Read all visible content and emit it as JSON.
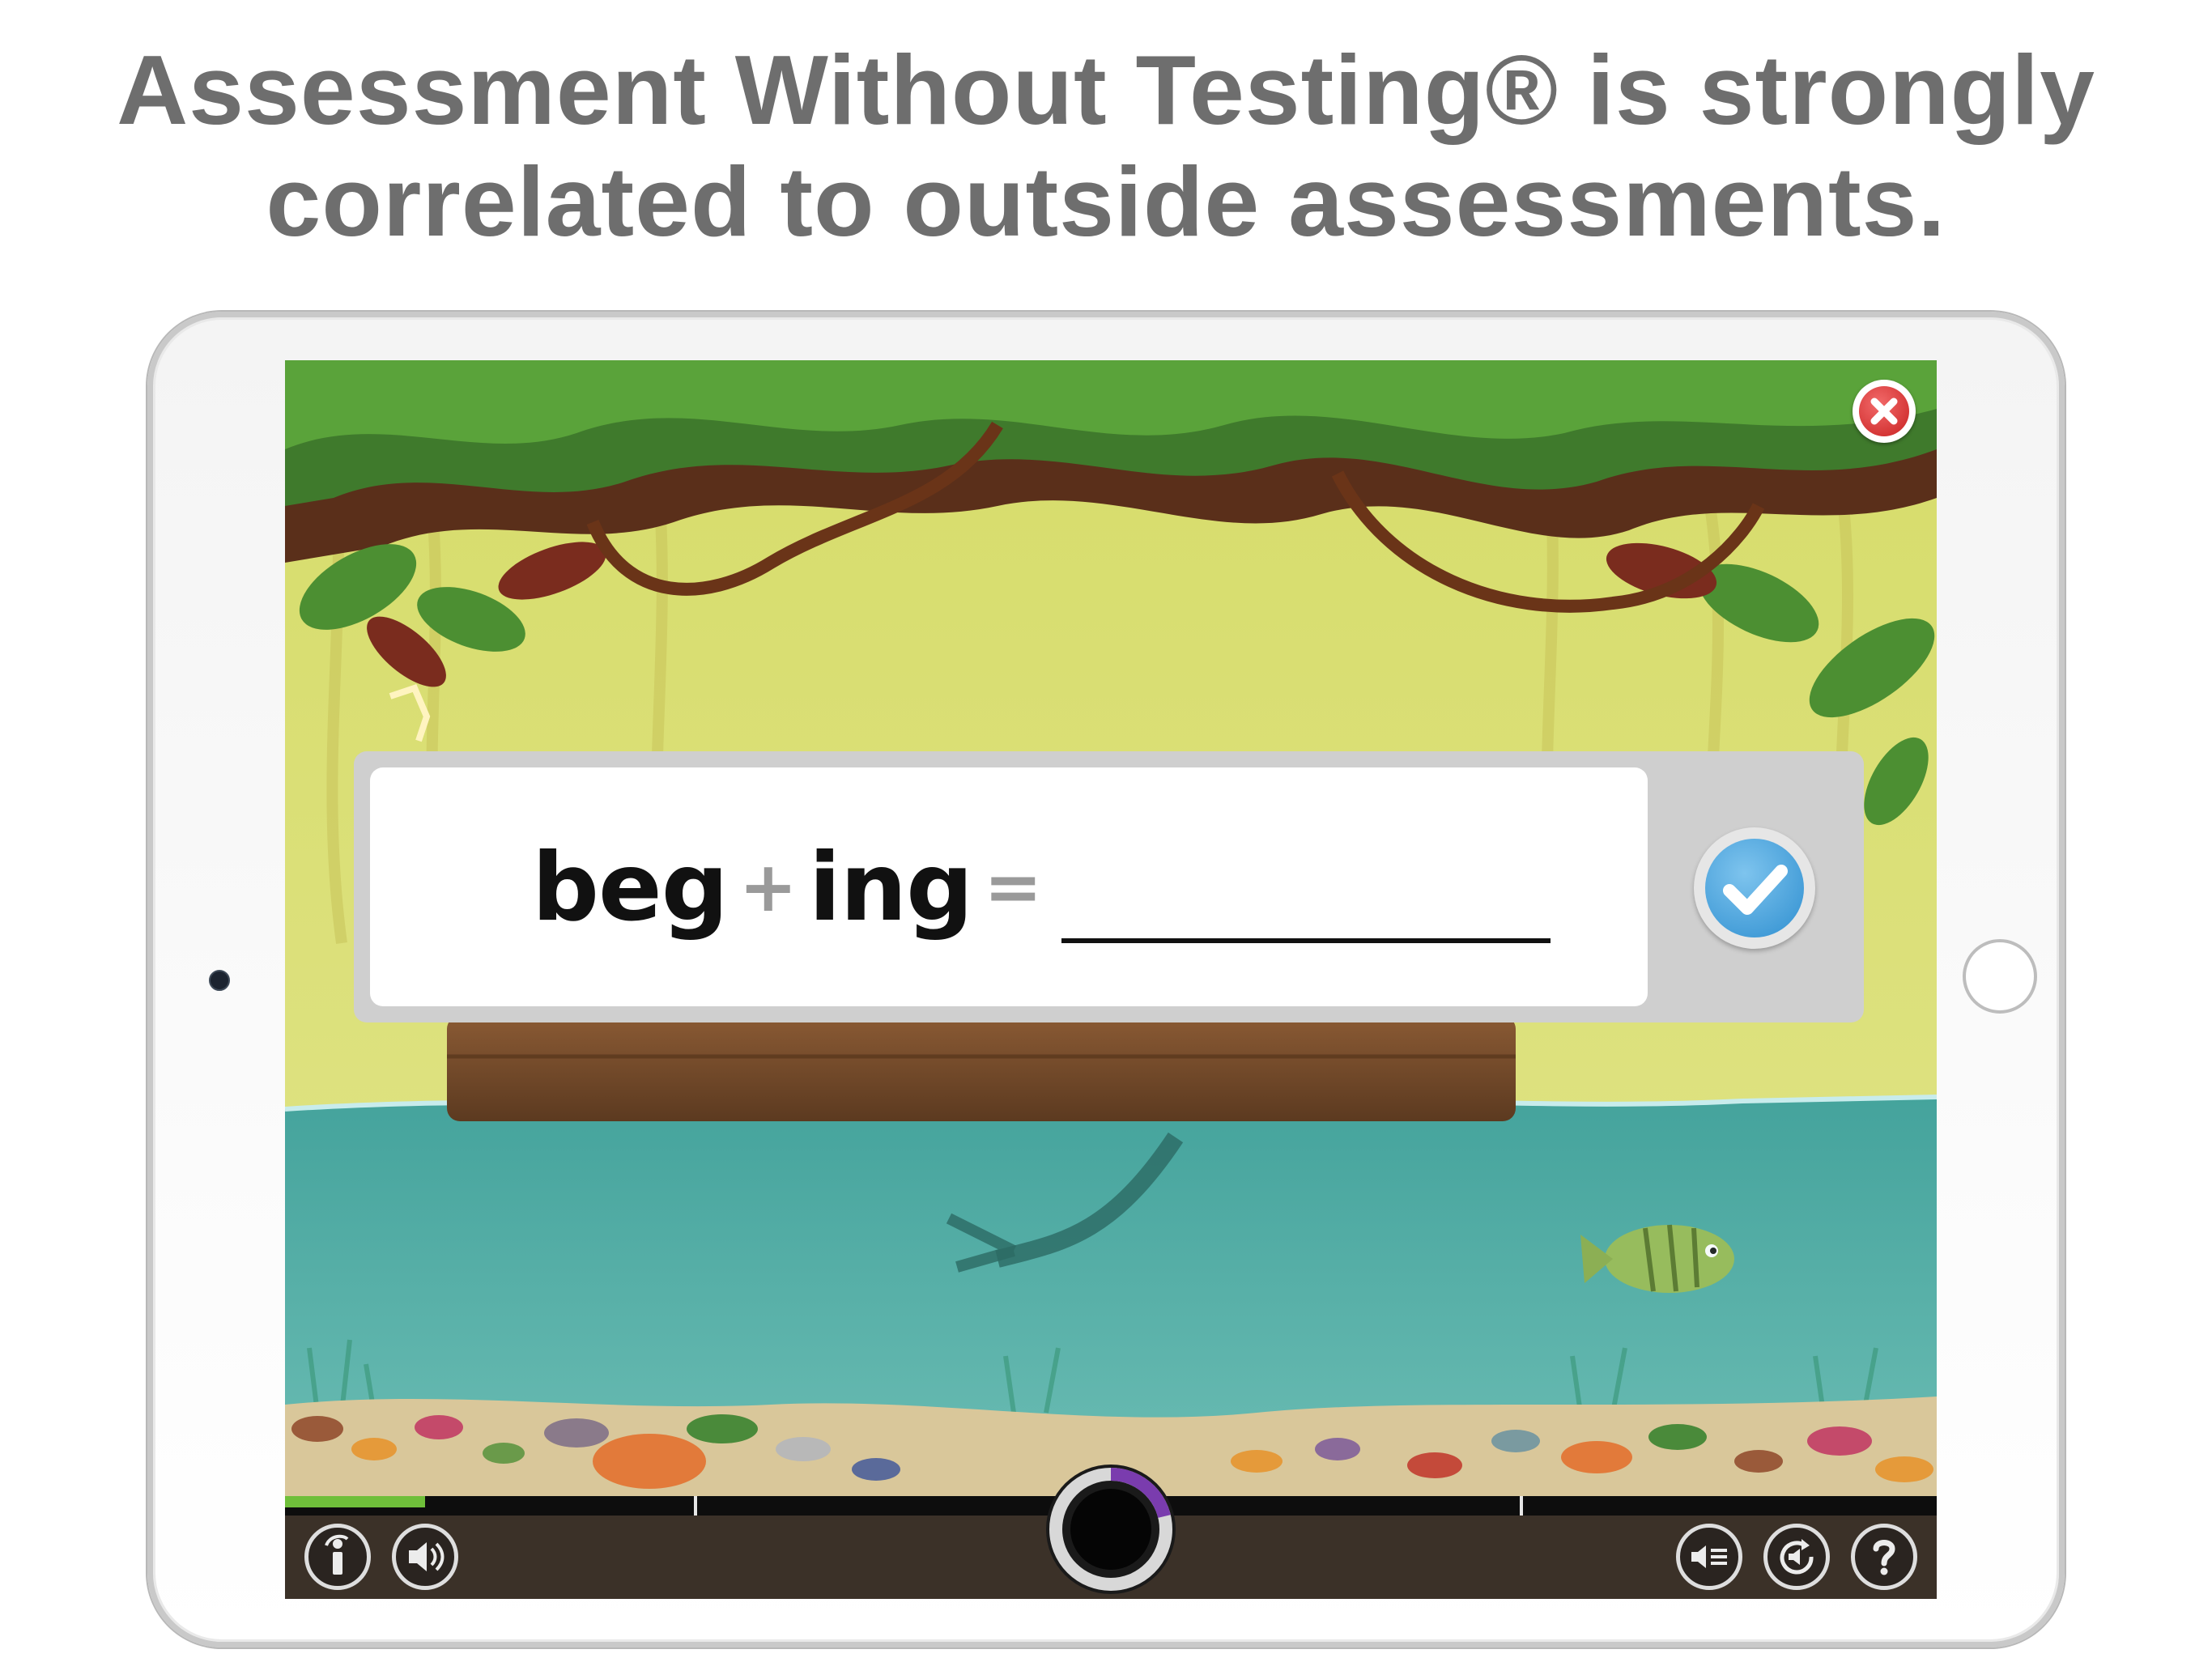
{
  "headline": {
    "line1": "Assessment Without Testing® is strongly",
    "line2": "correlated to outside assessments."
  },
  "exercise": {
    "base_word": "beg",
    "plus_sign": "+",
    "suffix": "ing",
    "equals_sign": "=",
    "answer_value": ""
  },
  "progress": {
    "fraction": 0.085
  },
  "colors": {
    "headline_text": "#6e6e6e",
    "progress_green": "#6fbf3a",
    "check_blue": "#2f8fd0",
    "close_red": "#c92121",
    "toolbar_brown": "#3b3128",
    "water_teal": "#4fa8a0",
    "jungle_yellow_green": "#dfe07a"
  },
  "icons": {
    "close": "close-icon",
    "check": "checkmark-icon",
    "info": "info-icon",
    "speaker": "speaker-icon",
    "replay_audio": "replay-audio-icon",
    "repeat": "repeat-icon",
    "help": "question-mark-icon",
    "timer": "timer-dial-icon"
  }
}
